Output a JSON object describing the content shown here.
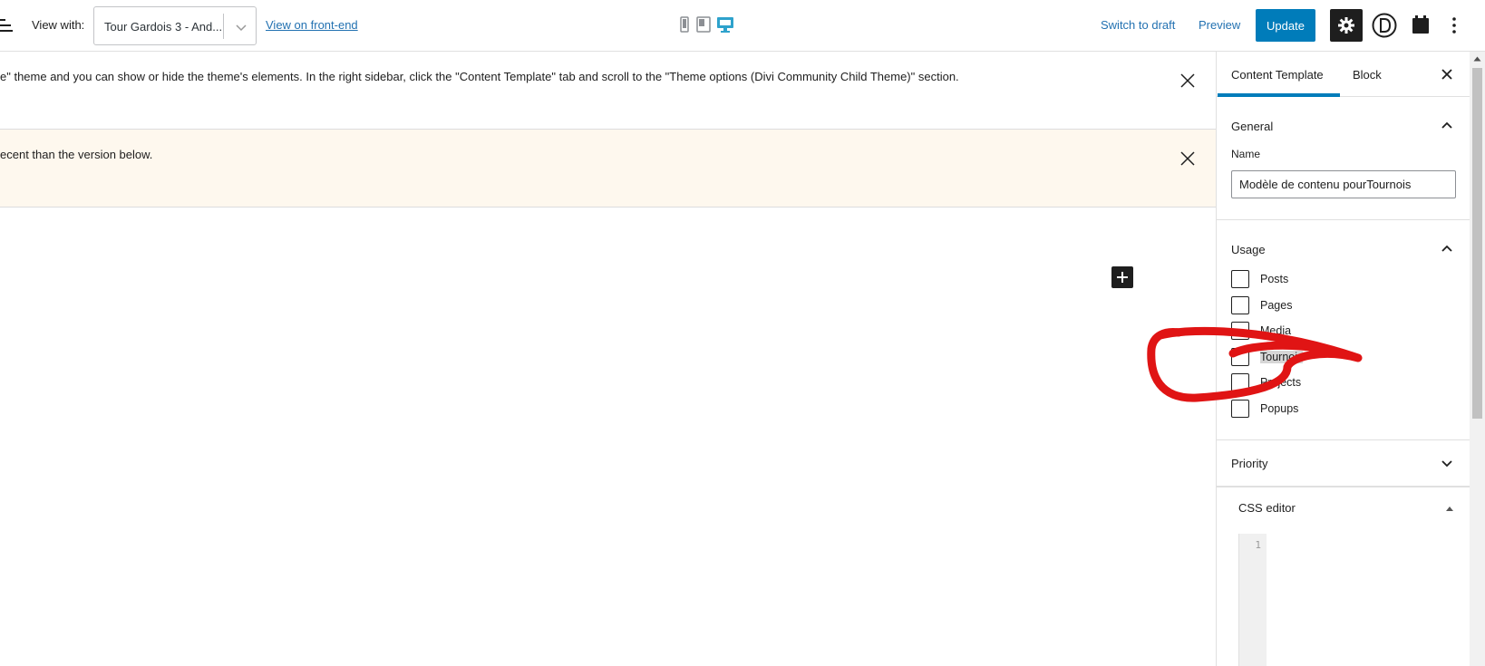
{
  "toolbar": {
    "view_with_label": "View with:",
    "view_select_value": "Tour Gardois 3 - And...",
    "view_frontend_link": "View on front-end",
    "switch_to_draft": "Switch to draft",
    "preview": "Preview",
    "update": "Update",
    "icons": [
      "menu-icon",
      "mobile-icon",
      "tablet-icon",
      "desktop-icon",
      "gear-icon",
      "divi-icon",
      "calendar-icon",
      "more-vertical-icon"
    ]
  },
  "notices": [
    {
      "text": "e\" theme and you can show or hide the theme's elements. In the right sidebar, click the \"Content Template\" tab and scroll to the \"Theme options (Divi Community Child Theme)\" section."
    },
    {
      "text": "ecent than the version below."
    }
  ],
  "sidebar": {
    "tabs": [
      "Content Template",
      "Block"
    ],
    "active_tab": "Content Template",
    "general": {
      "title": "General",
      "name_label": "Name",
      "name_value": "Modèle de contenu pourTournois"
    },
    "usage": {
      "title": "Usage",
      "items": [
        {
          "label": "Posts",
          "checked": false
        },
        {
          "label": "Pages",
          "checked": false
        },
        {
          "label": "Media",
          "checked": false
        },
        {
          "label": "Tournois",
          "checked": false
        },
        {
          "label": "Projects",
          "checked": false
        },
        {
          "label": "Popups",
          "checked": false
        }
      ]
    },
    "priority": {
      "title": "Priority"
    },
    "css_editor": {
      "title": "CSS editor",
      "line_number": "1"
    }
  },
  "colors": {
    "accent": "#007cba",
    "link": "#2271b1",
    "warning_bg": "#fef8ee",
    "annotation": "#e01414"
  }
}
